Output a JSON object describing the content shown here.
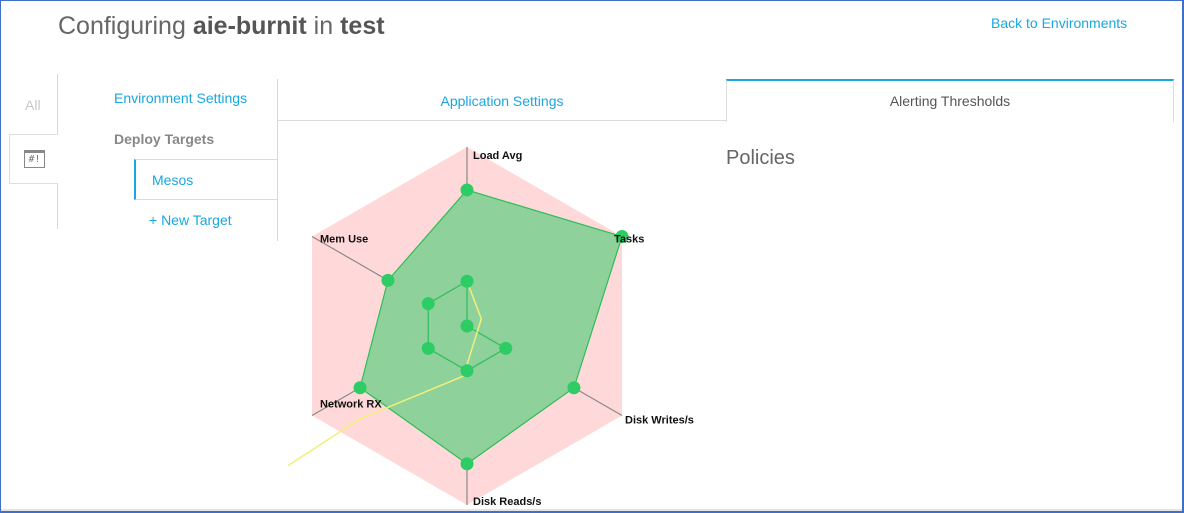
{
  "header": {
    "title_prefix": "Configuring",
    "app_name": "aie-burnit",
    "title_mid": "in",
    "env_name": "test",
    "back_link": "Back to Environments"
  },
  "leftbar": {
    "all_label": "All",
    "shebang_glyph": "#!"
  },
  "nav": {
    "environment_settings": "Environment Settings",
    "deploy_targets": "Deploy Targets",
    "targets": [
      "Mesos"
    ],
    "new_target": "+ New Target"
  },
  "tabs": {
    "application_settings": "Application Settings",
    "alerting_thresholds": "Alerting Thresholds",
    "active": "alerting_thresholds"
  },
  "policies": {
    "heading": "Policies"
  },
  "colors": {
    "accent": "#1aa7e0",
    "radar_background": "#ffd9d9",
    "radar_fill": "#8fd19a",
    "radar_stroke": "#2ebd5c",
    "radar_point": "#2ecc64",
    "guide_line": "#f2ef7a"
  },
  "chart_data": {
    "type": "radar",
    "axes": [
      "Load Avg",
      "Tasks",
      "Disk Writes/s",
      "Disk Reads/s",
      "Network RX",
      "Mem Use"
    ],
    "range": [
      0,
      1
    ],
    "series": [
      {
        "values": [
          0.76,
          1.0,
          0.69,
          0.77,
          0.69,
          0.51
        ]
      },
      {
        "values": [
          0.25,
          0.0,
          0.25,
          0.25,
          0.25,
          0.25
        ]
      }
    ],
    "guide_points": [
      [
        0.25,
        0
      ],
      [
        0.08,
        0.04
      ],
      [
        0.4,
        0.28
      ],
      [
        1.15,
        0.8
      ],
      [
        1.3,
        0.9
      ]
    ]
  }
}
